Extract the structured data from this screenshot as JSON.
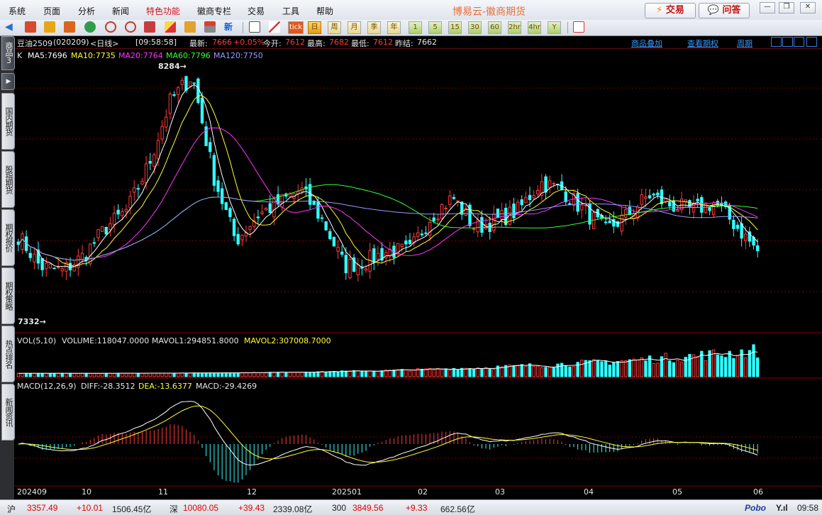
{
  "menu": {
    "items": [
      "系统",
      "页面",
      "分析",
      "新闻",
      "特色功能",
      "徽商专栏",
      "交易",
      "工具",
      "帮助"
    ],
    "highlighted_index": 4
  },
  "app_title": "博易云-徽商期货",
  "header_buttons": {
    "trade": "交易",
    "qa": "问答"
  },
  "window_controls": [
    "minimize",
    "restore",
    "close"
  ],
  "toolbar": {
    "periods": [
      "日",
      "周",
      "月",
      "季",
      "年",
      "1",
      "5",
      "15",
      "30",
      "60",
      "2hr",
      "4hr",
      "Y"
    ],
    "selected_period": "日",
    "tick_label": "tick",
    "new_label": "新"
  },
  "sidebar": {
    "tabs": [
      "商品3",
      "国内期货",
      "股指期货",
      "期权报价",
      "期权策略",
      "热点排名",
      "新闻资讯"
    ],
    "active_index": 0
  },
  "quote_line": {
    "contract": "豆油2509",
    "code": "(020209)",
    "period_label": "<日线>",
    "time": "[09:58:58]",
    "latest_label": "最新:",
    "latest": "7666",
    "change": "+0.05%",
    "open_label": "今开:",
    "open": "7612",
    "high_label": "最高:",
    "high": "7682",
    "low_label": "最低:",
    "low": "7612",
    "settle_label": "昨结:",
    "settle": "7662",
    "links": [
      "商品叠加",
      "查看期权",
      "周期"
    ]
  },
  "ma_legend": {
    "prefix": "K",
    "items": [
      {
        "label": "MA5:7696",
        "color": "#ffffff"
      },
      {
        "label": "MA10:7735",
        "color": "#ffff33"
      },
      {
        "label": "MA20:7764",
        "color": "#ff33ff"
      },
      {
        "label": "MA60:7796",
        "color": "#33ff33"
      },
      {
        "label": "MA120:7750",
        "color": "#9999ff"
      }
    ]
  },
  "price_markers": {
    "high": "8284",
    "low": "7332"
  },
  "volume_legend": {
    "title": "VOL(5,10)",
    "volume": "VOLUME:118047.0000",
    "mavol1": "MAVOL1:294851.8000",
    "mavol2": "MAVOL2:307008.7000"
  },
  "macd_legend": {
    "title": "MACD(12,26,9)",
    "diff": "DIFF:-28.3512",
    "dea": "DEA:-13.6377",
    "macd": "MACD:-29.4269"
  },
  "time_axis": [
    "202409",
    "10",
    "11",
    "12",
    "202501",
    "02",
    "03",
    "04",
    "05",
    "06"
  ],
  "colors": {
    "up": "#ff3b3b",
    "down": "#33ffff",
    "grid": "#7a0000",
    "ma5": "#ffffff",
    "ma10": "#ffff33",
    "ma20": "#ff33ff",
    "ma60": "#33ff33",
    "ma120": "#9999ff"
  },
  "chart_data": {
    "type": "candlestick",
    "candles_shown": 186,
    "highest": 8284,
    "lowest": 7332,
    "close_anchors": [
      7620,
      7500,
      7480,
      7540,
      7650,
      7720,
      7900,
      8150,
      8250,
      7850,
      7600,
      7700,
      7750,
      7800,
      7680,
      7500,
      7520,
      7560,
      7560,
      7700,
      7770,
      7650,
      7680,
      7720,
      7830,
      7800,
      7720,
      7640,
      7700,
      7780,
      7740,
      7720,
      7750,
      7660,
      7560
    ]
  },
  "status": {
    "sh_label": "沪",
    "sh_index": "3357.49",
    "sh_change": "+10.01",
    "sh_amount": "1506.45亿",
    "sz_label": "深",
    "sz_index": "10080.05",
    "sz_change": "+39.43",
    "sz_amount": "2339.08亿",
    "c300_label": "300",
    "c300_index": "3849.56",
    "c300_change": "+9.33",
    "c300_amount": "662.56亿",
    "brand": "Pobo",
    "clock": "09:58"
  }
}
